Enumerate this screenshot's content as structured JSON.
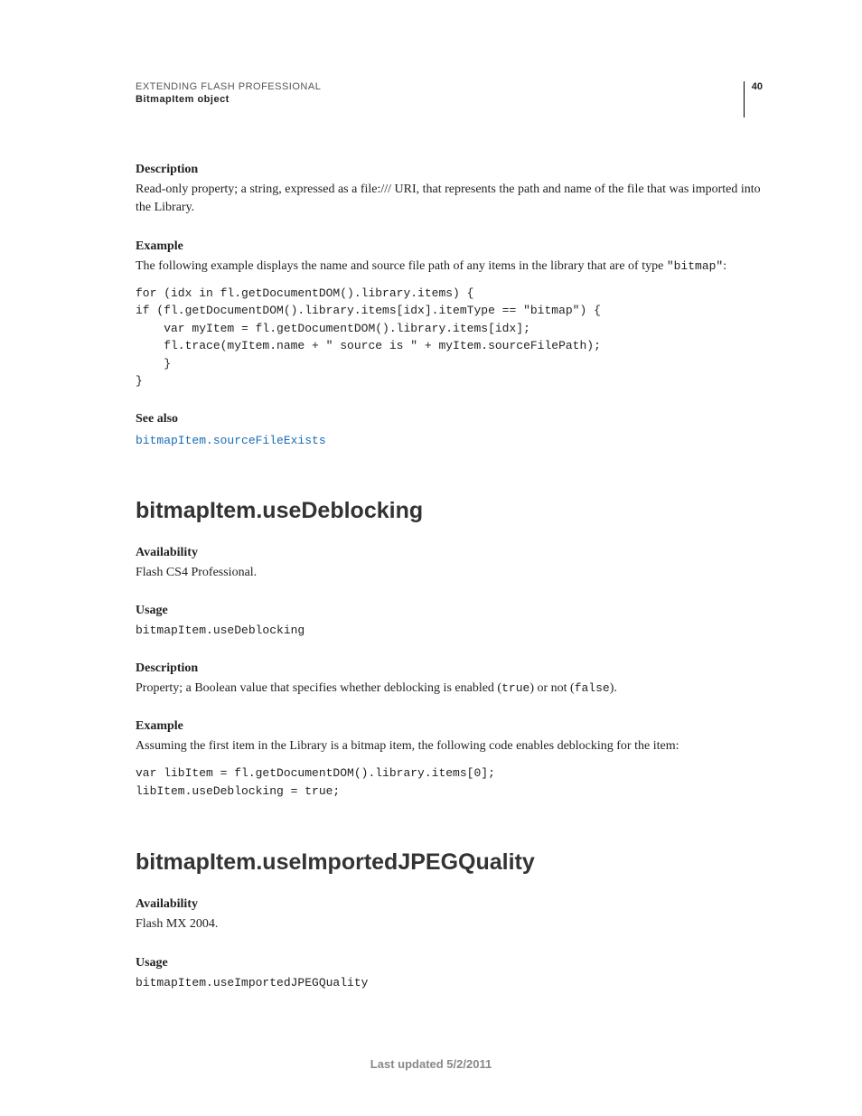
{
  "header": {
    "title": "EXTENDING FLASH PROFESSIONAL",
    "subtitle": "BitmapItem object",
    "page_number": "40"
  },
  "top": {
    "desc_label": "Description",
    "desc_text": "Read-only property; a string, expressed as a file:/// URI, that represents the path and name of the file that was imported into the Library.",
    "example_label": "Example",
    "example_intro_pre": "The following example displays the name and source file path of any items in the library that are of type ",
    "example_intro_code": "\"bitmap\"",
    "example_intro_post": ":",
    "example_code": "for (idx in fl.getDocumentDOM().library.items) {\nif (fl.getDocumentDOM().library.items[idx].itemType == \"bitmap\") {\n    var myItem = fl.getDocumentDOM().library.items[idx];\n    fl.trace(myItem.name + \" source is \" + myItem.sourceFilePath);\n    }\n}",
    "see_also_label": "See also",
    "see_also_link": "bitmapItem.sourceFileExists"
  },
  "sec1": {
    "heading": "bitmapItem.useDeblocking",
    "avail_label": "Availability",
    "avail_text": "Flash CS4 Professional.",
    "usage_label": "Usage",
    "usage_code": "bitmapItem.useDeblocking",
    "desc_label": "Description",
    "desc_pre": "Property; a Boolean value that specifies whether deblocking is enabled (",
    "desc_true": "true",
    "desc_mid": ") or not (",
    "desc_false": "false",
    "desc_post": ").",
    "example_label": "Example",
    "example_intro": "Assuming the first item in the Library is a bitmap item, the following code enables deblocking for the item:",
    "example_code": "var libItem = fl.getDocumentDOM().library.items[0];\nlibItem.useDeblocking = true;"
  },
  "sec2": {
    "heading": "bitmapItem.useImportedJPEGQuality",
    "avail_label": "Availability",
    "avail_text": "Flash MX 2004.",
    "usage_label": "Usage",
    "usage_code": "bitmapItem.useImportedJPEGQuality"
  },
  "footer": {
    "text": "Last updated 5/2/2011"
  }
}
